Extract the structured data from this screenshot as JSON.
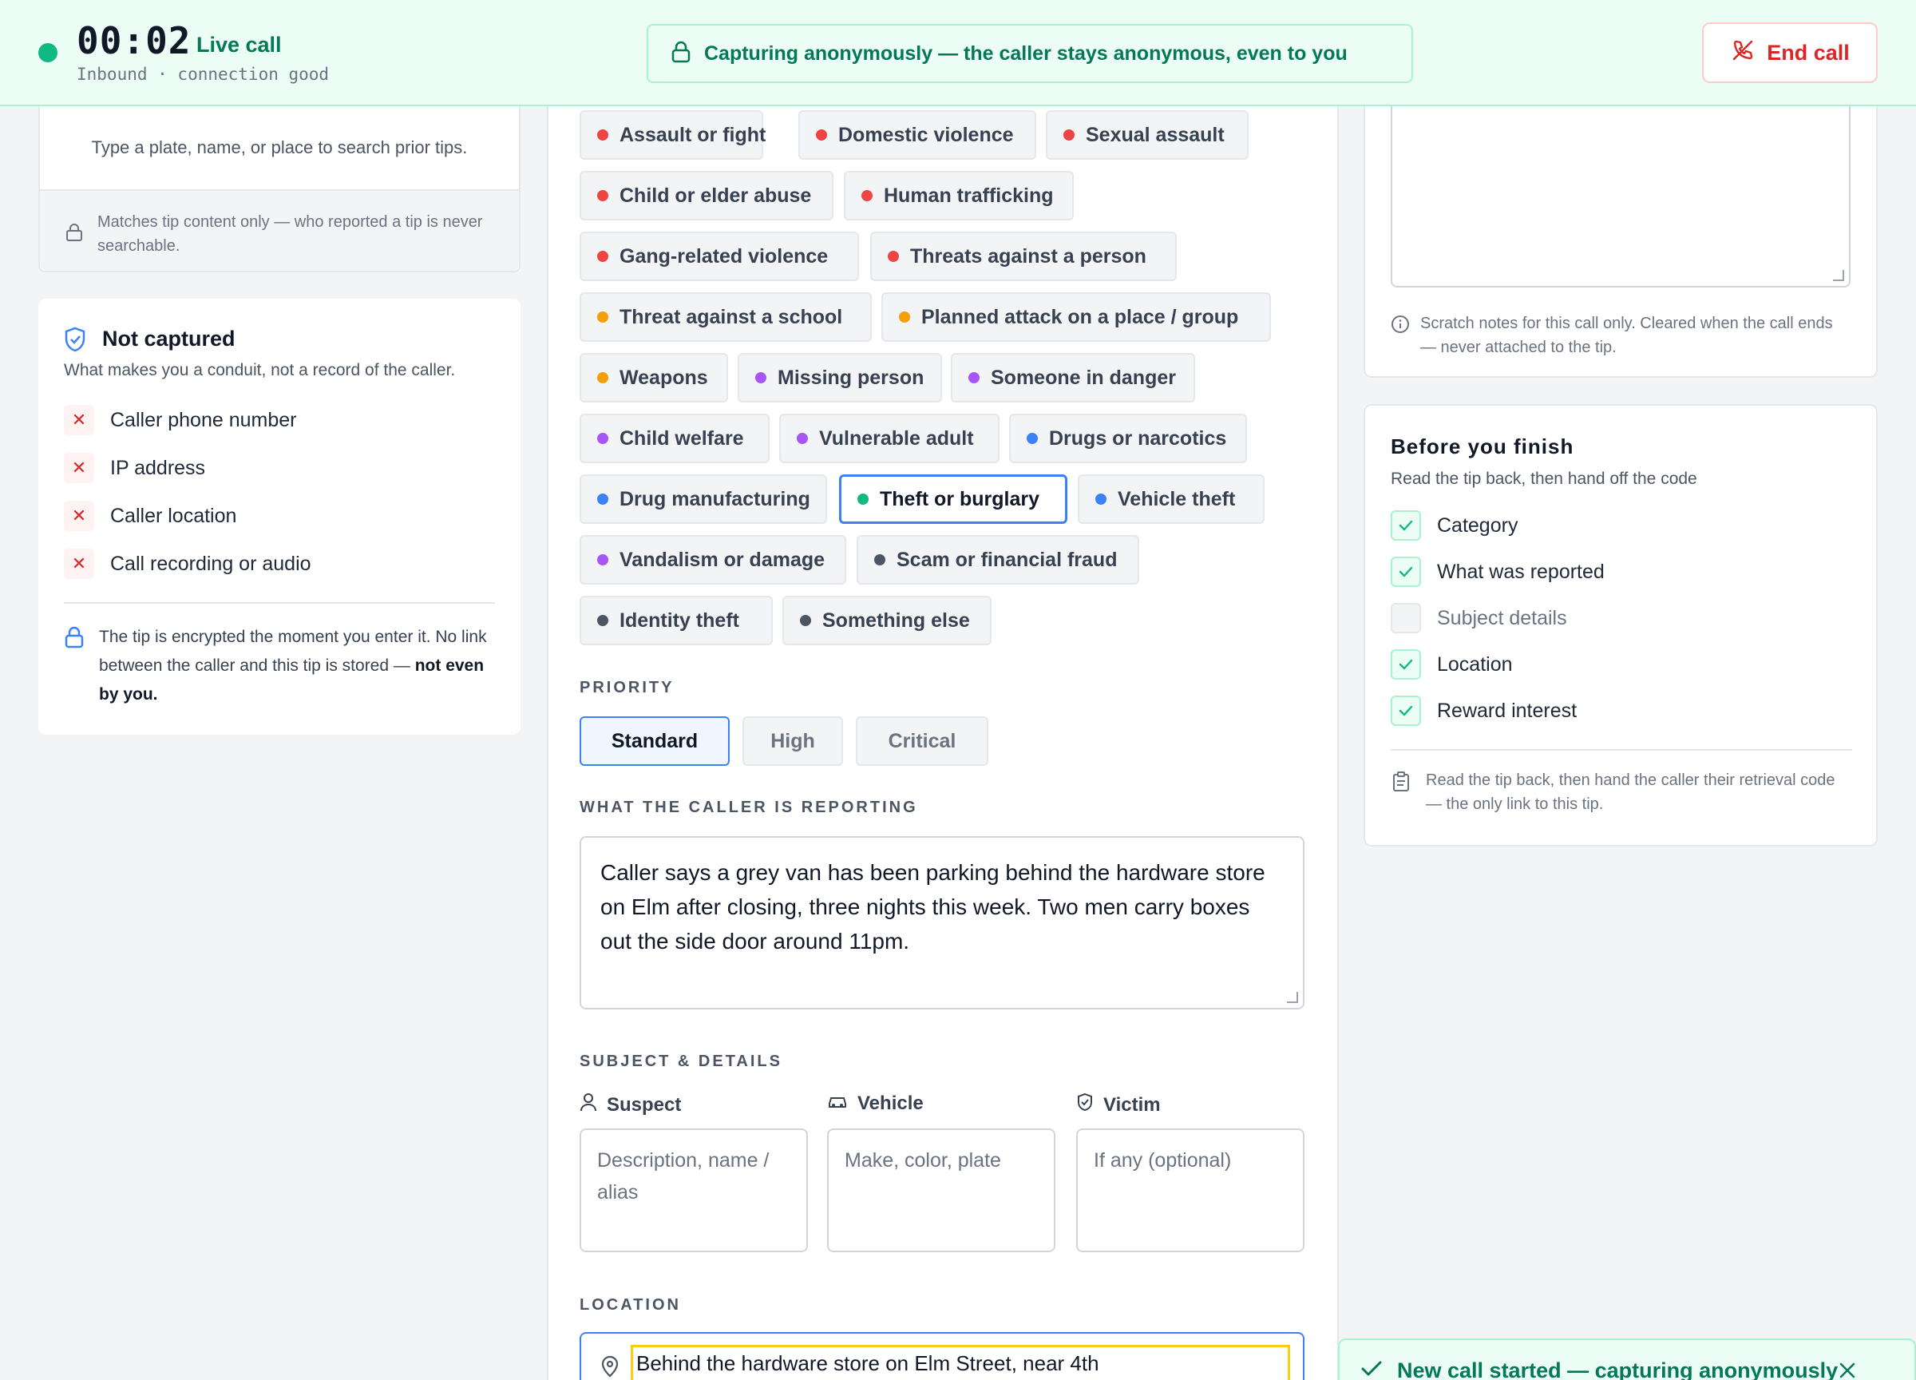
{
  "header": {
    "timer": "00:02",
    "live_label": "Live call",
    "connection": "Inbound · connection good",
    "anon_banner": "Capturing anonymously — the caller stays anonymous, even to you",
    "end_call": "End call"
  },
  "search": {
    "hint": "Type a plate, name, or place to search prior tips.",
    "note": "Matches tip content only — who reported a tip is never searchable."
  },
  "not_captured": {
    "title": "Not captured",
    "subtitle": "What makes you a conduit, not a record of the caller.",
    "items": [
      "Caller phone number",
      "IP address",
      "Caller location",
      "Call recording or audio"
    ],
    "encryption_text": "The tip is encrypted the moment you enter it. No link between the caller and this tip is stored —",
    "encryption_bold": "not even by you."
  },
  "categories": [
    {
      "label": "Assault or fight",
      "color": "#ef4444"
    },
    {
      "label": "Domestic violence",
      "color": "#ef4444"
    },
    {
      "label": "Sexual assault",
      "color": "#ef4444"
    },
    {
      "label": "Child or elder abuse",
      "color": "#ef4444"
    },
    {
      "label": "Human trafficking",
      "color": "#ef4444"
    },
    {
      "label": "Gang-related violence",
      "color": "#ef4444"
    },
    {
      "label": "Threats against a person",
      "color": "#ef4444"
    },
    {
      "label": "Threat against a school",
      "color": "#f59e0b"
    },
    {
      "label": "Planned attack on a place / group",
      "color": "#f59e0b"
    },
    {
      "label": "Weapons",
      "color": "#f59e0b"
    },
    {
      "label": "Missing person",
      "color": "#a855f7"
    },
    {
      "label": "Someone in danger",
      "color": "#a855f7"
    },
    {
      "label": "Child welfare",
      "color": "#a855f7"
    },
    {
      "label": "Vulnerable adult",
      "color": "#a855f7"
    },
    {
      "label": "Drugs or narcotics",
      "color": "#3b82f6"
    },
    {
      "label": "Drug manufacturing",
      "color": "#3b82f6"
    },
    {
      "label": "Theft or burglary",
      "color": "#10b981",
      "selected": true
    },
    {
      "label": "Vehicle theft",
      "color": "#3b82f6"
    },
    {
      "label": "Vandalism or damage",
      "color": "#a855f7"
    },
    {
      "label": "Scam or financial fraud",
      "color": "#4b5563"
    },
    {
      "label": "Identity theft",
      "color": "#4b5563"
    },
    {
      "label": "Something else",
      "color": "#4b5563"
    }
  ],
  "priority": {
    "label": "PRIORITY",
    "options": [
      "Standard",
      "High",
      "Critical"
    ],
    "selected": "Standard"
  },
  "report": {
    "label": "WHAT THE CALLER IS REPORTING",
    "text": "Caller says a grey van has been parking behind the hardware store on Elm after closing, three nights this week. Two men carry boxes out the side door around 11pm."
  },
  "subject": {
    "label": "SUBJECT & DETAILS",
    "suspect_label": "Suspect",
    "suspect_placeholder": "Description, name / alias",
    "vehicle_label": "Vehicle",
    "vehicle_placeholder": "Make, color, plate",
    "victim_label": "Victim",
    "victim_placeholder": "If any (optional)"
  },
  "location": {
    "label": "LOCATION",
    "value": "Behind the hardware store on Elm Street, near 4th"
  },
  "notes": {
    "note": "Scratch notes for this call only. Cleared when the call ends — never attached to the tip."
  },
  "finish": {
    "title": "Before you finish",
    "subtitle": "Read the tip back, then hand off the code",
    "items": [
      {
        "label": "Category",
        "done": true
      },
      {
        "label": "What was reported",
        "done": true
      },
      {
        "label": "Subject details",
        "done": false
      },
      {
        "label": "Location",
        "done": true
      },
      {
        "label": "Reward interest",
        "done": true
      }
    ],
    "note": "Read the tip back, then hand the caller their retrieval code — the only link to this tip."
  },
  "toast": {
    "text": "New call started — capturing anonymously"
  },
  "colors": {
    "accent_green": "#047857",
    "danger": "#dc2626",
    "focus_blue": "#3b82f6"
  }
}
